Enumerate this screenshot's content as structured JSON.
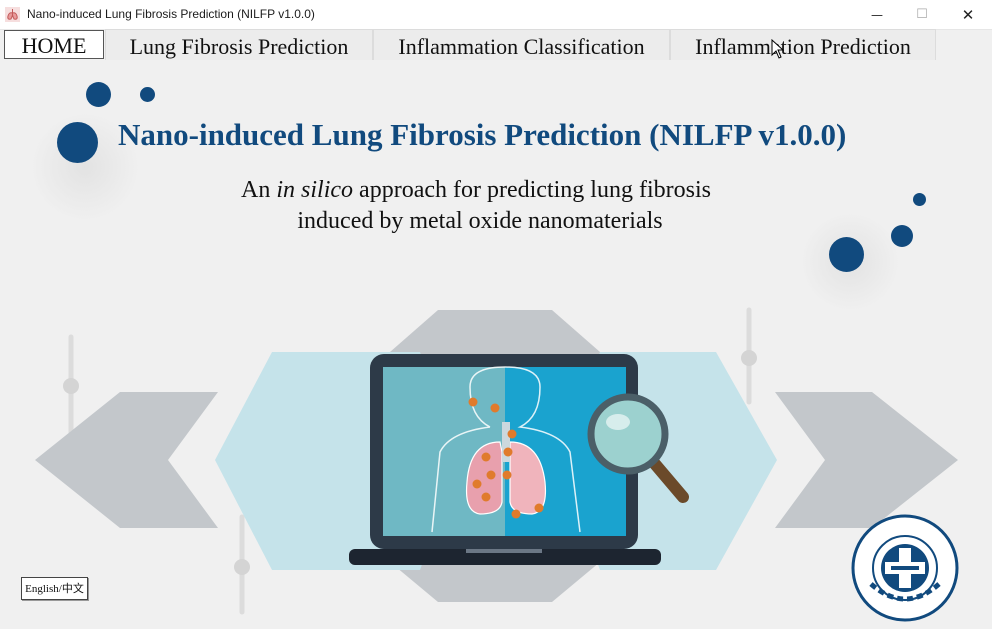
{
  "window": {
    "title": "Nano-induced Lung Fibrosis Prediction (NILFP v1.0.0)",
    "minimize_glyph": "—",
    "maximize_glyph": "☐",
    "close_glyph": "✕"
  },
  "tabs": [
    {
      "label": "HOME",
      "active": true
    },
    {
      "label": "Lung Fibrosis Prediction",
      "active": false
    },
    {
      "label": "Inflammation Classification",
      "active": false
    },
    {
      "label": "Inflammation Prediction",
      "active": false
    }
  ],
  "home": {
    "heading": "Nano-induced Lung Fibrosis Prediction (NILFP v1.0.0)",
    "subtitle_prefix": "An ",
    "subtitle_italic": "in silico",
    "subtitle_rest": " approach for predicting lung fibrosis",
    "subtitle_line2": "induced by metal oxide nanomaterials",
    "language_button": "English/中文"
  },
  "colors": {
    "accent": "#114a7e",
    "hexagon_light": "#c5e3ea",
    "arrow_gray": "#c3c7cb",
    "screen_left": "#6fb8c4",
    "screen_right": "#1aa3cf",
    "laptop_frame": "#2d3a48",
    "particle": "#e07b2c"
  },
  "icons": {
    "app": "lungs-icon",
    "logo": "university-seal-icon",
    "illustration": "laptop-lung-scan-illustration"
  }
}
